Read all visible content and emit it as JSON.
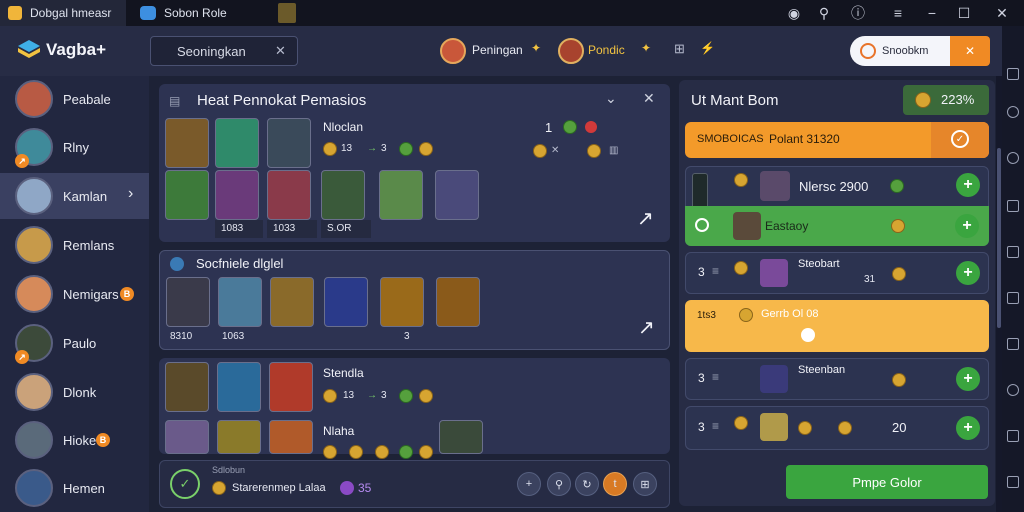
{
  "titlebar": {
    "tab1": "Dobgal hmeasr",
    "tab2": "Sobon Role"
  },
  "header": {
    "logo": "Vagba+",
    "search_placeholder": "Seoningkan",
    "profile1": "Peningan",
    "profile2": "Pondic",
    "search_chip": "Snoobkm",
    "chip_icon": "✕"
  },
  "sidebar": {
    "items": [
      {
        "label": "Peabale"
      },
      {
        "label": "Rlny"
      },
      {
        "label": "Kamlan"
      },
      {
        "label": "Remlans"
      },
      {
        "label": "Nemigars"
      },
      {
        "label": "Paulo"
      },
      {
        "label": "Dlonk"
      },
      {
        "label": "Hioke"
      },
      {
        "label": "Hemen"
      }
    ]
  },
  "main": {
    "title": "Heat Pennokat Pemasios",
    "section1": {
      "name": "Nloclan",
      "stat": "13",
      "stat2": "3",
      "count": "1",
      "labels": [
        "1083",
        "1033",
        "S.OR"
      ]
    },
    "section2": {
      "title": "Socfniele dlglel",
      "labels": [
        "8310",
        "1063",
        "3"
      ]
    },
    "section3": {
      "name": "Stendla",
      "stat": "13",
      "stat2": "3"
    },
    "section4": {
      "name": "Nlaha"
    },
    "footer": {
      "tag": "Sdlobun",
      "text": "Starerenmep Lalaa",
      "num": "35"
    }
  },
  "right": {
    "title": "Ut Mant Bom",
    "gold": "223%",
    "banner_text": "SMOBOICAS",
    "banner_price": "Polant 31320",
    "rows": [
      {
        "label": "Nlersc 2900"
      },
      {
        "label": "Eastaoy"
      },
      {
        "label": "Steobart",
        "num": "3",
        "val": "31"
      },
      {
        "label": "Gerrb Ol 08",
        "num": "1ts3"
      },
      {
        "label": "Steenban",
        "num": "3"
      },
      {
        "label": "20",
        "num": "3"
      }
    ],
    "action": "Pmpe Golor"
  },
  "colors": {
    "accent_orange": "#f39a2a",
    "accent_green": "#3aa53f",
    "panel": "#2d3352"
  }
}
